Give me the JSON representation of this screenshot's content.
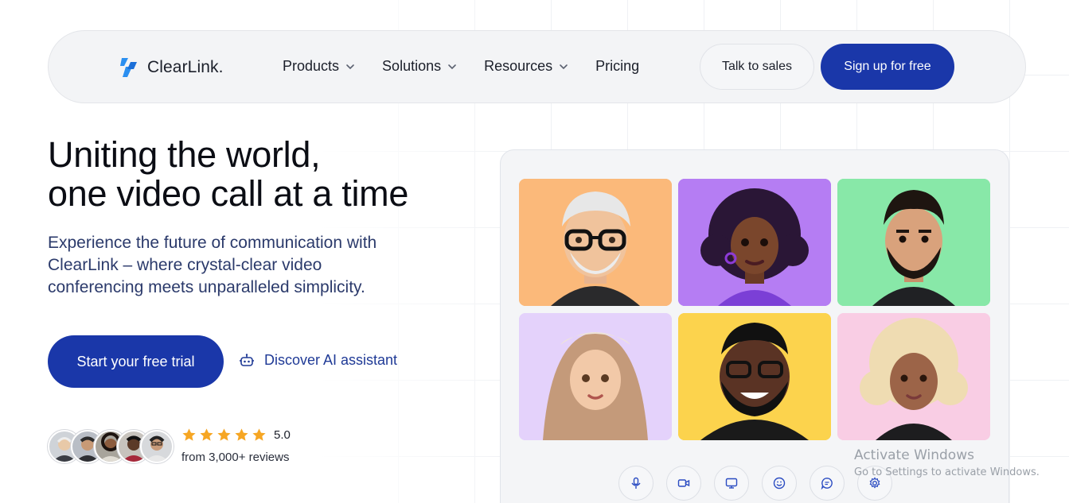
{
  "nav": {
    "logo_text": "ClearLink.",
    "menu": [
      {
        "label": "Products",
        "has_dropdown": true
      },
      {
        "label": "Solutions",
        "has_dropdown": true
      },
      {
        "label": "Resources",
        "has_dropdown": true
      },
      {
        "label": "Pricing",
        "has_dropdown": false
      }
    ],
    "talk_to_sales": "Talk to sales",
    "sign_up": "Sign up for free"
  },
  "hero": {
    "title_line1": "Uniting the world,",
    "title_line2": "one video call at a time",
    "subtitle": "Experience the future of communication with ClearLink – where crystal-clear video conferencing meets unparalleled simplicity.",
    "cta_primary": "Start your free trial",
    "cta_secondary": "Discover AI assistant"
  },
  "reviews": {
    "stars": 5,
    "rating": "5.0",
    "count_text": "from 3,000+ reviews"
  },
  "video_panel": {
    "tiles": [
      {
        "name": "older-man-glasses",
        "bg": "#fbb97a"
      },
      {
        "name": "woman-curly-hair",
        "bg": "#b57df3"
      },
      {
        "name": "bearded-man",
        "bg": "#88e8a8"
      },
      {
        "name": "woman-hijab",
        "bg": "#e4d2fb"
      },
      {
        "name": "smiling-man-glasses",
        "bg": "#fcd34d"
      },
      {
        "name": "woman-blonde-curls",
        "bg": "#f9cde4"
      }
    ],
    "controls": [
      "mic-icon",
      "video-camera-icon",
      "screen-share-icon",
      "emoji-icon",
      "chat-icon",
      "settings-icon"
    ]
  },
  "watermark": {
    "title": "Activate Windows",
    "subtitle": "Go to Settings to activate Windows."
  },
  "colors": {
    "brand_blue": "#1a37a9",
    "star_orange": "#f6a623",
    "logo_blue": "#2b8ff0"
  }
}
